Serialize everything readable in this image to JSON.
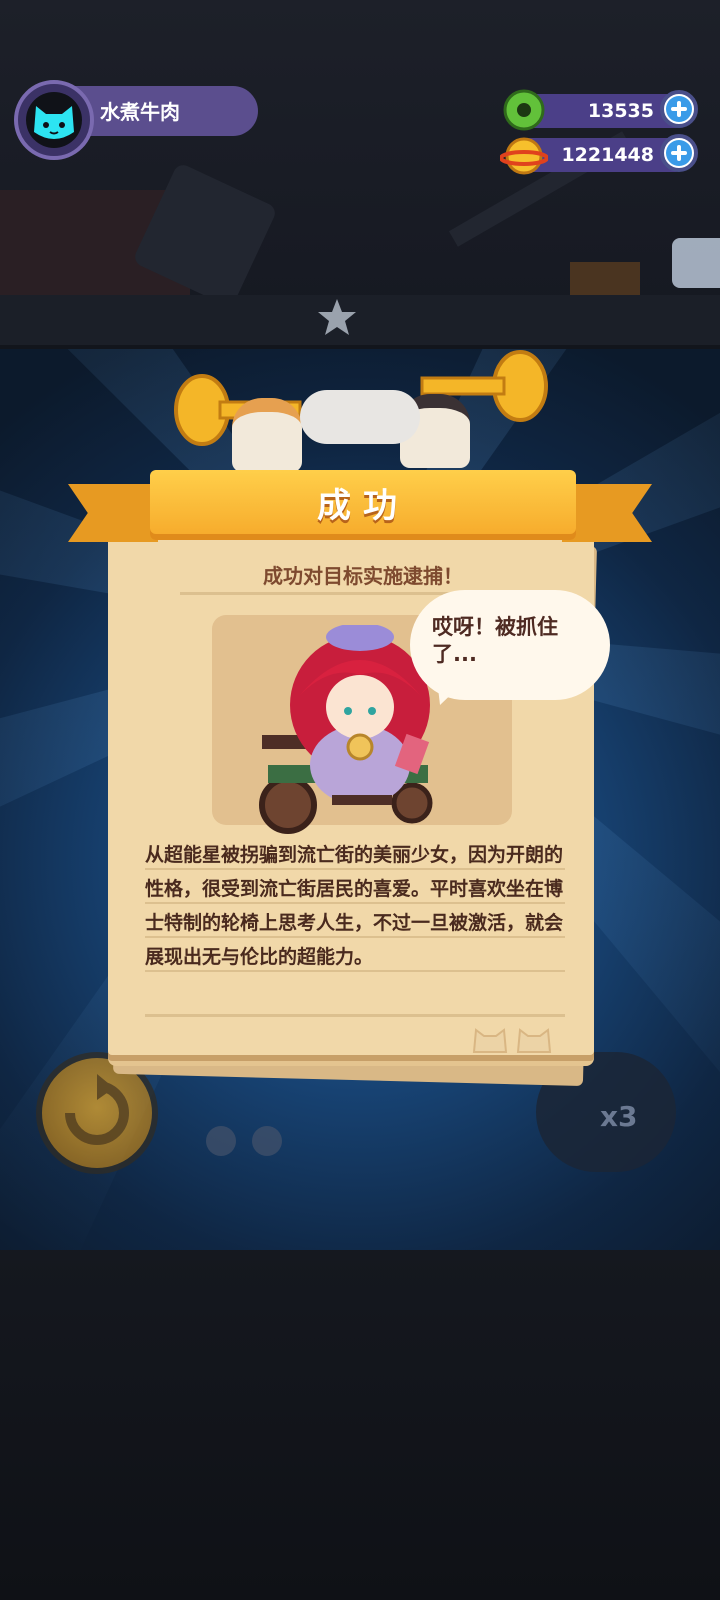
{
  "header": {
    "username": "水煮牛肉",
    "avatar_icon": "cat-face-icon",
    "currencies": [
      {
        "name": "donut",
        "icon": "donut-icon",
        "value": "13535"
      },
      {
        "name": "planet-coin",
        "icon": "planet-coin-icon",
        "value": "1221448"
      }
    ]
  },
  "dialog": {
    "title": "成功",
    "subtitle": "成功对目标实施逮捕！",
    "speech": "哎呀！被抓住了...",
    "description": "从超能星被拐骗到流亡街的美丽少女，因为开朗的性格，很受到流亡街居民的喜爱。平时喜欢坐在博士特制的轮椅上思考人生，不过一旦被激活，就会展现出无与伦比的超能力。"
  },
  "controls": {
    "speed_label": "x3"
  },
  "colors": {
    "ribbon": "#f6a92a",
    "paper": "#f1d8a9",
    "text_brown": "#4a2a1e",
    "pill_purple": "#4b3f88",
    "plus_blue": "#3a9be8"
  }
}
